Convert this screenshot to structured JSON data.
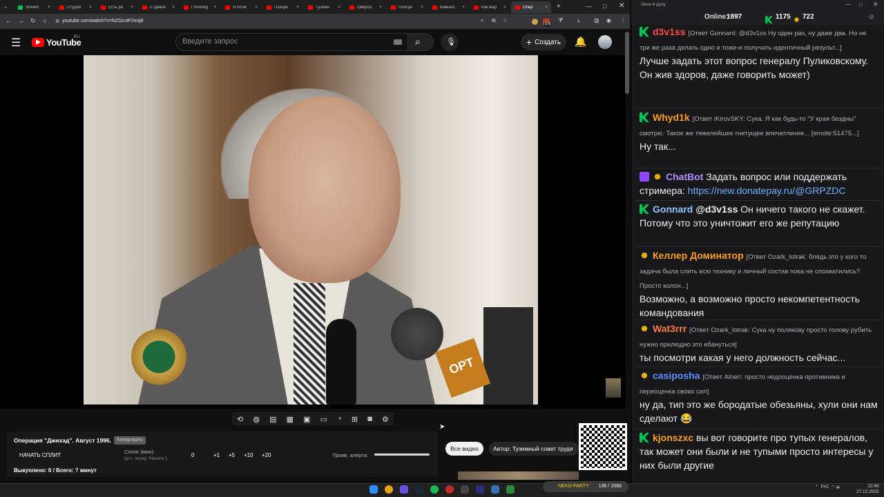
{
  "browser": {
    "tabs": [
      {
        "label": "Stream",
        "color": "#00c853"
      },
      {
        "label": "Студия",
        "color": "#ff0000"
      },
      {
        "label": "Есть ре",
        "color": "#ff0000"
      },
      {
        "label": "С Девон",
        "color": "#ff0000"
      },
      {
        "label": "I Investig",
        "color": "#ff0000"
      },
      {
        "label": "Я посм",
        "color": "#ff0000"
      },
      {
        "label": "Позорн",
        "color": "#ff0000"
      },
      {
        "label": "Туземн",
        "color": "#ff0000"
      },
      {
        "label": "Оверло",
        "color": "#ff0000"
      },
      {
        "label": "Позорн",
        "color": "#ff0000"
      },
      {
        "label": "Кавказс",
        "color": "#ff0000"
      },
      {
        "label": "Как мар",
        "color": "#ff0000"
      },
      {
        "label": "Опер",
        "color": "#ff0000"
      }
    ],
    "url": "youtube.com/watch?v=NZGcvtF2mq8",
    "badge_count": "576"
  },
  "youtube": {
    "logo_text": "YouTube",
    "logo_region": "RU",
    "search_placeholder": "Введите запрос",
    "create_label": "Создать"
  },
  "video": {
    "overlay_text": "ОРТ"
  },
  "extension": {
    "title": "Операция \"Джихад\". Август 1996.",
    "copy_label": "Копировать",
    "start_split": "НАЧАТЬ СПЛИТ",
    "split_label": "Сплит (мин):",
    "split_hint": "(уст. перед \"Начать\")",
    "split_options": [
      "0",
      "+1",
      "+5",
      "+10",
      "+20"
    ],
    "volume_label": "Громк. алерта:",
    "volume_level": 1.0,
    "bought_line": "Выкуплено: 0 / Всего: ? минут"
  },
  "side": {
    "all_videos": "Все видео",
    "author": "Автор: Туземный совет трудя"
  },
  "chat": {
    "window_title": "Окно в духу",
    "online_label": "Online:",
    "online_count": "1897",
    "stat2": "1175",
    "stat3": "722",
    "messages": [
      {
        "user": "d3v1ss",
        "color": "#ff4545",
        "reply": "[Ответ Gonnard: @d3v1ss Ну один раз, ну даже два. Но не три же раза делать одно и тоже-и получать идентичный результ...]",
        "text": "Лучше задать этот вопрос генералу Пуликовскому. Он жив здоров, даже говорить может)"
      },
      {
        "user": "Whyd1k",
        "color": "#ff9f1a",
        "reply": "[Ответ iKirovSKY: Сука. Я как будь-то \"У края бездны\" смотрю. Такое же тяжелейшее гнетущее впечатление... [emote:51475...]",
        "text": "Ну так..."
      },
      {
        "user": "ChatBot",
        "color": "#b28cff",
        "text": "Задать вопрос или поддержать стримера:",
        "link": "https://new.donatepay.ru/@GRPZDC"
      },
      {
        "user": "Gonnard",
        "color": "#8cc8ff",
        "mention": "@d3v1ss",
        "text": "Он ничего такого не скажет. Потому что это уничтожит его же репутацию"
      },
      {
        "user": "Келлер Доминатор",
        "color": "#ff9f1a",
        "reply": "[Ответ Ozark_lotrak: блядь это у кого то задача была слить всю технику и личный состав пока не спохватились? Просто колон...]",
        "text": "Возможно, а возможно просто некомпетентность командования"
      },
      {
        "user": "Wat3rrr",
        "color": "#ff7a45",
        "reply": "[Ответ Ozark_lotrak: Сука ну полякову просто голову рубить нужно прилюдно это ебануться]",
        "text": "ты посмотри какая у него должность сейчас..."
      },
      {
        "user": "casiposha",
        "color": "#5c8fff",
        "reply": "[Ответ Alneri: просто недооценка противника и переоценка своих сил]",
        "text": "ну да, тип это же бородатые обезьяны, хули они нам сделают"
      },
      {
        "user": "kjonszxc",
        "color": "#ff9f1a",
        "text": "вы вот говорите про тупых генералов, так может они были и не тупыми просто интересы у них были другие"
      }
    ]
  },
  "taskbar": {
    "party_label": "NEKO-PARTY",
    "party_value": "135 / 1590",
    "lang": "РУС",
    "time": "22:49",
    "date": "27.12.2025"
  },
  "colors": {
    "accent": "#ff0000",
    "chat_bg": "#18181b",
    "yt_bg": "#0f0f0f"
  }
}
